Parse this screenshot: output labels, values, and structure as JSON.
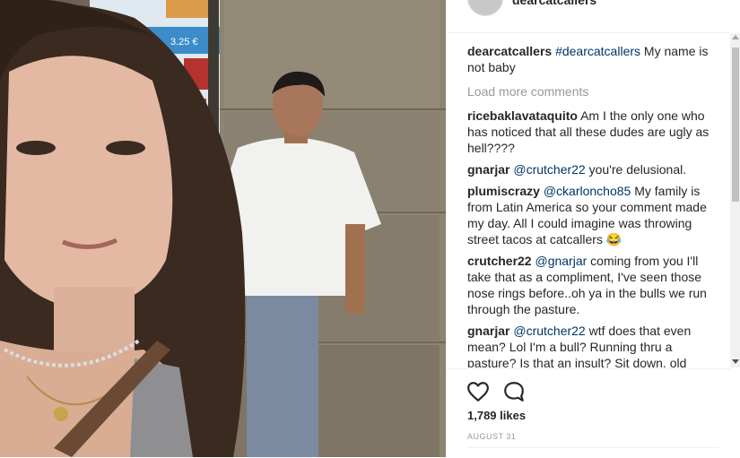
{
  "header": {
    "username": "dearcatcallers"
  },
  "caption": {
    "user": "dearcatcallers",
    "mention": "#dearcatcallers",
    "text": " My name is not baby"
  },
  "load_more_label": "Load more comments",
  "comments": [
    {
      "user": "ricebaklavataquito",
      "mention": "",
      "text": "Am I the only one who has noticed that all these dudes are ugly as hell????"
    },
    {
      "user": "gnarjar",
      "mention": "@crutcher22",
      "text": " you're delusional."
    },
    {
      "user": "plumiscrazy",
      "mention": "@ckarloncho85",
      "text": " My family is from Latin America so your comment made my day. All I could imagine was throwing street tacos at catcallers 😂"
    },
    {
      "user": "crutcher22",
      "mention": "@gnarjar",
      "text": " coming from you I'll take that as a compliment, I've seen those nose rings before..oh ya in the bulls we run through the pasture."
    },
    {
      "user": "gnarjar",
      "mention": "@crutcher22",
      "text": " wtf does that even mean? Lol I'm a bull? Running thru a pasture? Is that an insult? Sit down, old"
    }
  ],
  "likes": "1,789 likes",
  "date": "AUGUST 31",
  "photo_sign_price": "3.25 €",
  "icons": {
    "like": "heart-icon",
    "comment": "comment-bubble-icon"
  }
}
